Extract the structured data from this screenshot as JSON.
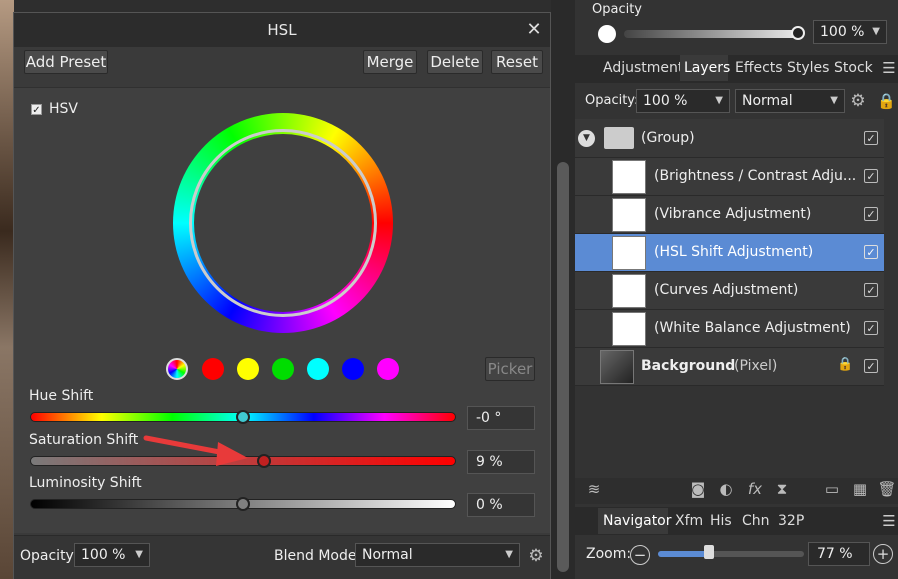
{
  "dialog": {
    "title": "HSL",
    "buttons": {
      "add_preset": "Add Preset",
      "merge": "Merge",
      "delete": "Delete",
      "reset": "Reset"
    },
    "hsv_label": "HSV",
    "hsv_checked": true,
    "picker_label": "Picker",
    "swatches": [
      "#ff0000",
      "#ffff00",
      "#00dd00",
      "#00ffff",
      "#0000ff",
      "#ff00ff"
    ],
    "hue_shift": {
      "label": "Hue Shift",
      "value": "-0 °",
      "level": 0.5
    },
    "saturation_shift": {
      "label": "Saturation Shift",
      "value": "9 %",
      "level": 0.55
    },
    "luminosity_shift": {
      "label": "Luminosity Shift",
      "value": "0 %",
      "level": 0.5
    },
    "footer": {
      "opacity_label": "Opacity:",
      "opacity_value": "100 %",
      "blend_label": "Blend Mode:",
      "blend_value": "Normal"
    }
  },
  "top_opacity": {
    "label": "Opacity",
    "value": "100 %"
  },
  "panel_tabs": [
    "Adjustment",
    "Layers",
    "Effects",
    "Styles",
    "Stock"
  ],
  "active_tab": "Layers",
  "layers_toolbar": {
    "opacity_label": "Opacity:",
    "opacity_value": "100 %",
    "blend_value": "Normal"
  },
  "layers": [
    {
      "name": "(Group)"
    },
    {
      "name": "(Brightness / Contrast Adju..."
    },
    {
      "name": "(Vibrance Adjustment)"
    },
    {
      "name": "(HSL Shift Adjustment)",
      "selected": true
    },
    {
      "name": "(Curves Adjustment)"
    },
    {
      "name": "(White Balance Adjustment)"
    },
    {
      "name": "Background",
      "suffix": "(Pixel)"
    }
  ],
  "nav_tabs": [
    "Navigator",
    "Xfm",
    "His",
    "Chn",
    "32P"
  ],
  "zoom": {
    "label": "Zoom:",
    "value": "77 %",
    "level": 0.35
  },
  "colors": {
    "accent": "#5b8bd4"
  }
}
